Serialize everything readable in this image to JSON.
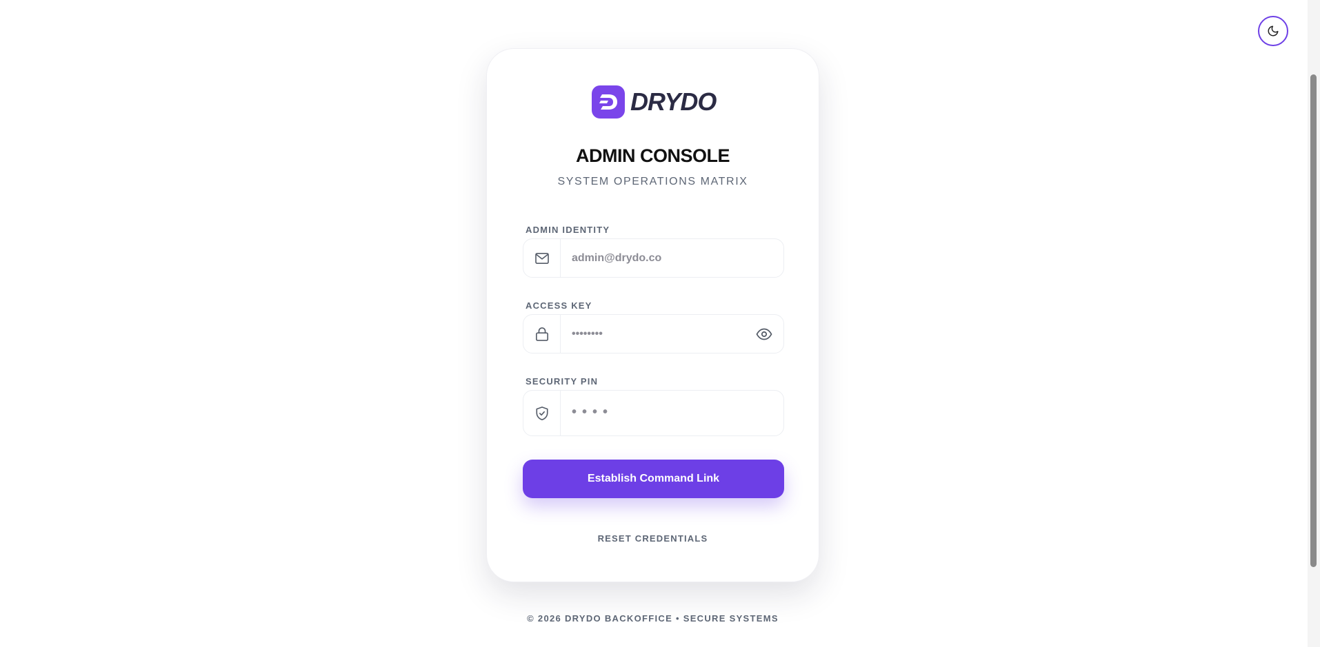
{
  "theme_toggle": {
    "icon": "moon-icon"
  },
  "brand": {
    "name": "DRYDO",
    "logo_color": "#7a45ea"
  },
  "header": {
    "title": "ADMIN CONSOLE",
    "subtitle": "SYSTEM OPERATIONS MATRIX"
  },
  "form": {
    "identity": {
      "label": "ADMIN IDENTITY",
      "placeholder": "admin@drydo.co",
      "icon": "mail-icon"
    },
    "access_key": {
      "label": "ACCESS KEY",
      "placeholder": "••••••••",
      "icon": "lock-icon",
      "toggle_icon": "eye-icon"
    },
    "pin": {
      "label": "SECURITY PIN",
      "placeholder": "••••",
      "icon": "shield-check-icon"
    },
    "submit_label": "Establish Command Link",
    "reset_label": "RESET CREDENTIALS"
  },
  "footer": {
    "text": "© 2026 DRYDO BACKOFFICE • SECURE SYSTEMS"
  },
  "colors": {
    "accent": "#6d3fe6",
    "muted_text": "#5d6675",
    "title_text": "#111111"
  }
}
